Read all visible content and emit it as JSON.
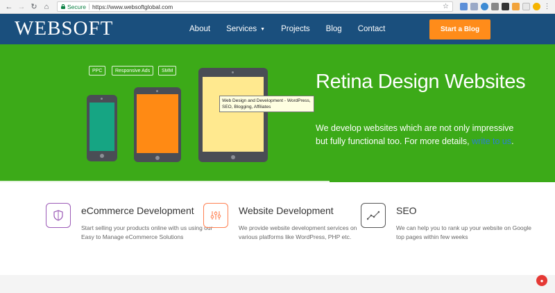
{
  "browser": {
    "secure_label": "Secure",
    "url": "https://www.websoftglobal.com"
  },
  "site": {
    "logo": "WEBSOFT",
    "menu": [
      {
        "label": "About"
      },
      {
        "label": "Services"
      },
      {
        "label": "Projects"
      },
      {
        "label": "Blog"
      },
      {
        "label": "Contact"
      }
    ],
    "cta_label": "Start a Blog"
  },
  "hero": {
    "tags": [
      "PPC",
      "Responsive Ads",
      "SMM"
    ],
    "title": "Retina Design Websites",
    "text": "We develop websites which are not only impressive but fully functional too. For more details, ",
    "link_text": "write to us",
    "text_end": ".",
    "tooltip": "Web Design and Development - WordPress, SEO, Blogging, Affiliates",
    "colors": {
      "phone_screen": "#16a583",
      "tablet_screen": "#ff8a14",
      "large_screen": "#ffe98f",
      "background": "#3caa18"
    }
  },
  "services": [
    {
      "title": "eCommerce Development",
      "desc": "Start selling your products online with us using our Easy to Manage eCommerce Solutions",
      "icon": "shield-icon",
      "color": "#9b59b6"
    },
    {
      "title": "Website Development",
      "desc": "We provide website development services on various platforms like WordPress, PHP etc.",
      "icon": "sliders-icon",
      "color": "#ff7f50"
    },
    {
      "title": "SEO",
      "desc": "We can help you to rank up your website on Google top pages within few weeks",
      "icon": "chart-line-icon",
      "color": "#555555"
    }
  ]
}
